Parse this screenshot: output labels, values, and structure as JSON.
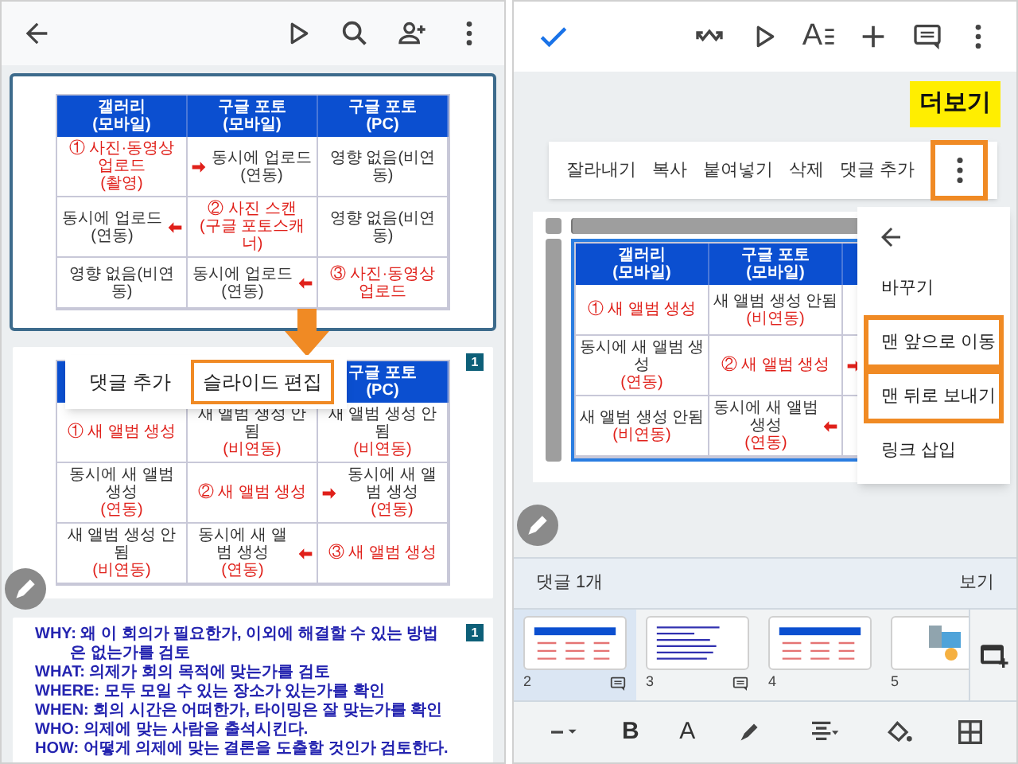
{
  "left_screen": {
    "slides": [
      {
        "kind": "table",
        "selected": true,
        "columns": [
          {
            "lines": [
              "갤러리",
              "(모바일)"
            ]
          },
          {
            "lines": [
              "구글 포토",
              "(모바일)"
            ]
          },
          {
            "lines": [
              "구글 포토",
              "(PC)"
            ]
          }
        ],
        "rows": [
          [
            {
              "lines": [
                {
                  "text": "① 사진·동영상 업로드",
                  "emphasis": true
                },
                {
                  "text": "(촬영)",
                  "emphasis": true
                }
              ]
            },
            {
              "arrow_right": true,
              "lines": [
                {
                  "text": "동시에 업로드(연동)",
                  "emphasis": false
                }
              ]
            },
            {
              "lines": [
                {
                  "text": "영향 없음(비연동)",
                  "emphasis": false
                }
              ]
            }
          ],
          [
            {
              "arrow_left": true,
              "lines": [
                {
                  "text": "동시에 업로드(연동)",
                  "emphasis": false
                }
              ]
            },
            {
              "lines": [
                {
                  "text": "② 사진 스캔",
                  "emphasis": true
                },
                {
                  "text": "(구글 포토스캐너)",
                  "emphasis": true
                }
              ]
            },
            {
              "lines": [
                {
                  "text": "영향 없음(비연동)",
                  "emphasis": false
                }
              ]
            }
          ],
          [
            {
              "lines": [
                {
                  "text": "영향 없음(비연동)",
                  "emphasis": false
                }
              ]
            },
            {
              "arrow_left": true,
              "lines": [
                {
                  "text": "동시에 업로드(연동)",
                  "emphasis": false
                }
              ]
            },
            {
              "lines": [
                {
                  "text": "③ 사진·동영상 업로드",
                  "emphasis": true
                }
              ]
            }
          ]
        ]
      },
      {
        "kind": "table",
        "selected": false,
        "comment_count": "1",
        "columns": [
          {},
          {},
          {
            "lines": [
              "구글 포토",
              "(PC)"
            ]
          }
        ],
        "rows": [
          [
            {
              "lines": [
                {
                  "text": "① 새 앨범 생성",
                  "emphasis": true
                }
              ]
            },
            {
              "lines": [
                {
                  "text": "새 앨범 생성 안됨",
                  "emphasis": false
                },
                {
                  "text": "(비연동)",
                  "emphasis": true
                }
              ]
            },
            {
              "lines": [
                {
                  "text": "새 앨범 생성 안됨",
                  "emphasis": false
                },
                {
                  "text": "(비연동)",
                  "emphasis": true
                }
              ]
            }
          ],
          [
            {
              "lines": [
                {
                  "text": "동시에 새 앨범 생성",
                  "emphasis": false
                },
                {
                  "text": "(연동)",
                  "emphasis": true
                }
              ]
            },
            {
              "lines": [
                {
                  "text": "② 새 앨범 생성",
                  "emphasis": true
                }
              ]
            },
            {
              "arrow_right": true,
              "lines": [
                {
                  "text": "동시에 새 앨범 생성",
                  "emphasis": false
                },
                {
                  "text": "(연동)",
                  "emphasis": true
                }
              ]
            }
          ],
          [
            {
              "lines": [
                {
                  "text": "새 앨범 생성 안됨",
                  "emphasis": false
                },
                {
                  "text": "(비연동)",
                  "emphasis": true
                }
              ]
            },
            {
              "arrow_left": true,
              "lines": [
                {
                  "text": "동시에 새 앨범 생성",
                  "emphasis": false
                },
                {
                  "text": "(연동)",
                  "emphasis": true
                }
              ]
            },
            {
              "lines": [
                {
                  "text": "③ 새 앨범 생성",
                  "emphasis": true
                }
              ]
            }
          ]
        ]
      },
      {
        "kind": "text",
        "selected": false,
        "comment_count": "1",
        "paragraphs": [
          "WHY: 왜 이 회의가 필요한가, 이외에 해결할 수 있는 방법은 없는가를 검토",
          "WHAT: 의제가 회의 목적에 맞는가를 검토",
          "WHERE: 모두 모일 수 있는 장소가 있는가를 확인",
          "WHEN: 회의 시간은 어떠한가, 타이밍은 잘 맞는가를 확인",
          "WHO: 의제에 맞는 사람을 출석시킨다.",
          "HOW: 어떻게 의제에 맞는 결론을 도출할 것인가 검토한다."
        ]
      }
    ],
    "context_menu": [
      {
        "label": "댓글 추가",
        "highlighted": false
      },
      {
        "label": "슬라이드 편집",
        "highlighted": true
      }
    ]
  },
  "right_screen": {
    "toolbar": {
      "text_format_glyph": "A"
    },
    "callout_label": "더보기",
    "edit_bar": [
      {
        "label": "잘라내기"
      },
      {
        "label": "복사"
      },
      {
        "label": "붙여넣기"
      },
      {
        "label": "삭제"
      },
      {
        "label": "댓글 추가"
      }
    ],
    "more_highlighted": true,
    "slide": {
      "columns": [
        {
          "lines": [
            "갤러리",
            "(모바일)"
          ]
        },
        {
          "lines": [
            "구글 포토",
            "(모바일)"
          ]
        },
        {}
      ],
      "rows": [
        [
          {
            "lines": [
              {
                "text": "① 새 앨범 생성",
                "emphasis": true
              }
            ]
          },
          {
            "lines": [
              {
                "text": "새 앨범 생성 안됨",
                "emphasis": false
              },
              {
                "text": "(비연동)",
                "emphasis": true
              }
            ]
          },
          {}
        ],
        [
          {
            "lines": [
              {
                "text": "동시에 새 앨범 생성",
                "emphasis": false
              },
              {
                "text": "(연동)",
                "emphasis": true
              }
            ]
          },
          {
            "lines": [
              {
                "text": "② 새 앨범 생성",
                "emphasis": true
              }
            ]
          },
          {
            "arrow_right": true
          }
        ],
        [
          {
            "lines": [
              {
                "text": "새 앨범 생성 안됨",
                "emphasis": false
              },
              {
                "text": "(비연동)",
                "emphasis": true
              }
            ]
          },
          {
            "arrow_left": true,
            "lines": [
              {
                "text": "동시에 새 앨범 생성",
                "emphasis": false
              },
              {
                "text": "(연동)",
                "emphasis": true
              }
            ]
          },
          {}
        ]
      ]
    },
    "overflow_menu": [
      {
        "label": "바꾸기",
        "highlighted": false
      },
      {
        "label": "맨 앞으로 이동",
        "highlighted": true
      },
      {
        "label": "맨 뒤로 보내기",
        "highlighted": true
      },
      {
        "label": "링크 삽입",
        "highlighted": false
      }
    ],
    "comments_bar": {
      "count_label": "댓글 1개",
      "action": "보기"
    },
    "thumbnails": [
      {
        "number": "2",
        "kind": "table",
        "selected": true,
        "has_comment": true
      },
      {
        "number": "3",
        "kind": "text",
        "selected": false,
        "has_comment": true
      },
      {
        "number": "4",
        "kind": "table",
        "selected": false,
        "has_comment": false
      },
      {
        "number": "5",
        "kind": "image",
        "selected": false,
        "has_comment": false
      }
    ],
    "format_bar": {
      "bold_glyph": "B",
      "text_color_glyph": "A"
    }
  }
}
